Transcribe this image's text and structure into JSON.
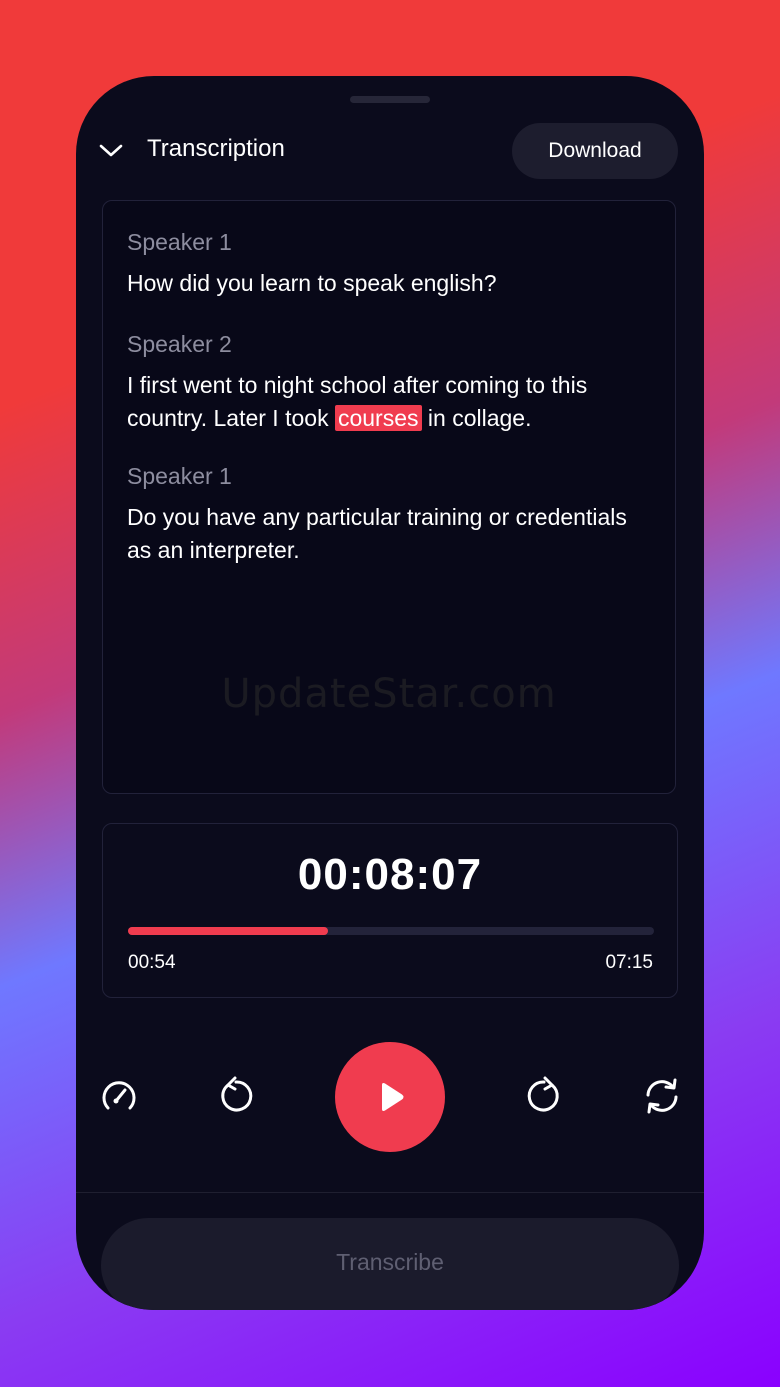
{
  "header": {
    "title": "Transcription",
    "download_label": "Download"
  },
  "transcript": [
    {
      "speaker": "Speaker 1",
      "parts": [
        "How did you learn to speak english?"
      ]
    },
    {
      "speaker": "Speaker 2",
      "parts": [
        "I first went to night school after coming to this country. Later I took ",
        "courses",
        " in collage."
      ],
      "highlight_index": 1
    },
    {
      "speaker": "Speaker 1",
      "parts": [
        "Do you have any particular training or credentials as an interpreter."
      ]
    }
  ],
  "watermark": "UpdateStar.com",
  "player": {
    "timer": "00:08:07",
    "elapsed": "00:54",
    "duration": "07:15",
    "progress": 0.38
  },
  "controls": {
    "speed_icon": "gauge-icon",
    "rewind_icon": "rewind-icon",
    "play_icon": "play-icon",
    "forward_icon": "forward-icon",
    "repeat_icon": "repeat-icon"
  },
  "footer": {
    "transcribe_label": "Transcribe"
  },
  "colors": {
    "accent": "#f03c4f",
    "panel": "#0b0b1c"
  }
}
